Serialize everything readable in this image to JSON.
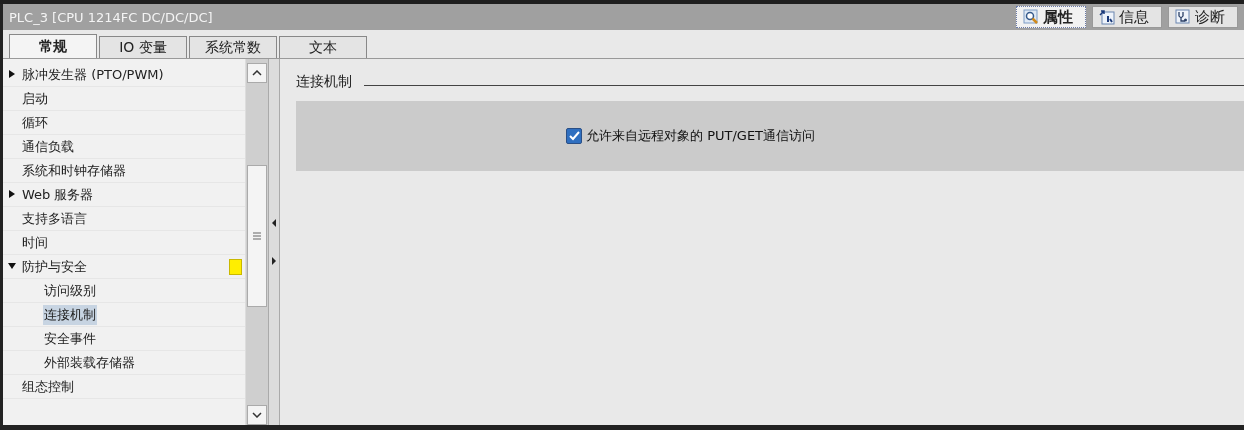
{
  "window": {
    "title": "PLC_3 [CPU 1214FC DC/DC/DC]"
  },
  "inspector_tabs": [
    {
      "label": "属性",
      "selected": true
    },
    {
      "label": "信息",
      "selected": false
    },
    {
      "label": "诊断",
      "selected": false
    }
  ],
  "tabs": [
    {
      "label": "常规",
      "selected": true
    },
    {
      "label": "IO 变量",
      "selected": false
    },
    {
      "label": "系统常数",
      "selected": false
    },
    {
      "label": "文本",
      "selected": false
    }
  ],
  "tree": [
    {
      "label": "脉冲发生器 (PTO/PWM)",
      "expanded": false,
      "selected": false,
      "marked": false
    },
    {
      "label": "启动",
      "selected": false,
      "marked": false
    },
    {
      "label": "循环",
      "selected": false,
      "marked": false
    },
    {
      "label": "通信负载",
      "selected": false,
      "marked": false
    },
    {
      "label": "系统和时钟存储器",
      "selected": false,
      "marked": false
    },
    {
      "label": "Web 服务器",
      "expanded": false,
      "selected": false,
      "marked": false
    },
    {
      "label": "支持多语言",
      "selected": false,
      "marked": false
    },
    {
      "label": "时间",
      "selected": false,
      "marked": false
    },
    {
      "label": "防护与安全",
      "expanded": true,
      "selected": false,
      "marked": true,
      "children": [
        {
          "label": "访问级别",
          "selected": false,
          "marked": false
        },
        {
          "label": "连接机制",
          "selected": true,
          "marked": false
        },
        {
          "label": "安全事件",
          "selected": false,
          "marked": false
        },
        {
          "label": "外部装载存储器",
          "selected": false,
          "marked": false
        }
      ]
    },
    {
      "label": "组态控制",
      "selected": false,
      "marked": false
    }
  ],
  "section": {
    "title": "连接机制",
    "options": [
      {
        "label": "允许来自远程对象的 PUT/GET通信访问",
        "checked": true
      }
    ]
  }
}
